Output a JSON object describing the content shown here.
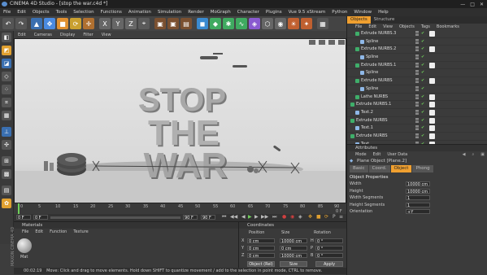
{
  "window": {
    "title": "CINEMA 4D Studio - [stop the war.c4d *]",
    "controls": [
      "—",
      "□",
      "✕"
    ]
  },
  "menu": [
    "File",
    "Edit",
    "Objects",
    "Tools",
    "Selection",
    "Functions",
    "Animation",
    "Simulation",
    "Render",
    "MoGraph",
    "Character",
    "Plugins",
    "Vue 9.5 xStream",
    "Python",
    "Window",
    "Help"
  ],
  "toolbar": {
    "axis": [
      "X",
      "Y",
      "Z"
    ]
  },
  "viewport": {
    "menu": [
      "Edit",
      "Cameras",
      "Display",
      "Filter",
      "View"
    ],
    "scene_text": [
      "STOP",
      "THE",
      "WAR"
    ]
  },
  "timeline": {
    "ticks": [
      "0",
      "5",
      "10",
      "15",
      "20",
      "25",
      "30",
      "35",
      "40",
      "45",
      "50",
      "55",
      "60",
      "65",
      "70",
      "75",
      "80",
      "85",
      "90"
    ],
    "start": "0 F",
    "current": "0 F",
    "end": "90 F",
    "max": "90 F",
    "frame_right": "0 F"
  },
  "materials": {
    "title": "Materials",
    "menu": [
      "File",
      "Edit",
      "Function",
      "Texture"
    ],
    "item_label": "Mat",
    "brand": "MAXON CINEMA 4D"
  },
  "coordinates": {
    "title": "Coordinates",
    "headers": [
      "Position",
      "Size",
      "Rotation"
    ],
    "rows": [
      {
        "axis": "X",
        "pos": "0 cm",
        "size": "10000 cm",
        "rot_axis": "H",
        "rot": "0 °"
      },
      {
        "axis": "Y",
        "pos": "0 cm",
        "size": "0 cm",
        "rot_axis": "P",
        "rot": "0 °"
      },
      {
        "axis": "Z",
        "pos": "0 cm",
        "size": "10000 cm",
        "rot_axis": "B",
        "rot": "0 °"
      }
    ],
    "mode_select": "Object (Rel)",
    "size_select": "Size",
    "apply": "Apply"
  },
  "status": {
    "time": "00:02:19",
    "message": "Move: Click and drag to move elements. Hold down SHIFT to quantize movement / add to the selection in point mode, CTRL to remove."
  },
  "object_manager": {
    "tabs": [
      "Objects",
      "Structure"
    ],
    "menu": [
      "File",
      "Edit",
      "View",
      "Objects",
      "Tags",
      "Bookmarks"
    ],
    "rows": [
      {
        "name": "Extrude NURBS.3",
        "indent": 1,
        "type": "nurbs"
      },
      {
        "name": "Spline",
        "indent": 2,
        "type": "spline"
      },
      {
        "name": "Extrude NURBS.2",
        "indent": 1,
        "type": "nurbs"
      },
      {
        "name": "Spline",
        "indent": 2,
        "type": "spline"
      },
      {
        "name": "Extrude NURBS.1",
        "indent": 1,
        "type": "nurbs"
      },
      {
        "name": "Spline",
        "indent": 2,
        "type": "spline"
      },
      {
        "name": "Extrude NURBS",
        "indent": 1,
        "type": "nurbs"
      },
      {
        "name": "Spline",
        "indent": 2,
        "type": "spline"
      },
      {
        "name": "Lathe NURBS",
        "indent": 1,
        "type": "nurbs"
      },
      {
        "name": "Extrude NURBS.1",
        "indent": 0,
        "type": "nurbs"
      },
      {
        "name": "Text.2",
        "indent": 1,
        "type": "text"
      },
      {
        "name": "Extrude NURBS",
        "indent": 0,
        "type": "nurbs"
      },
      {
        "name": "Text.1",
        "indent": 1,
        "type": "text"
      },
      {
        "name": "Extrude NURBS",
        "indent": 0,
        "type": "nurbs"
      },
      {
        "name": "Text",
        "indent": 1,
        "type": "text"
      },
      {
        "name": "Sphere",
        "indent": 1,
        "type": "sphere"
      }
    ]
  },
  "attributes": {
    "title": "Attributes",
    "menu": [
      "Mode",
      "Edit",
      "User Data"
    ],
    "object_title": "Plane Object [Plane.2]",
    "tabs": [
      "Basic",
      "Coord.",
      "Object",
      "Phong"
    ],
    "active_tab": "Object",
    "section": "Object Properties",
    "props": [
      {
        "label": "Width",
        "value": "10000 cm"
      },
      {
        "label": "Height",
        "value": "10000 cm"
      },
      {
        "label": "Width Segments",
        "value": "1"
      },
      {
        "label": "Height Segments",
        "value": "1"
      },
      {
        "label": "Orientation",
        "value": "+Y"
      }
    ]
  },
  "colors": {
    "accent": "#f0a030",
    "nurbs_icon": "#3fae6a",
    "spline_icon": "#8fb8e8",
    "check": "#6fcf5a"
  }
}
